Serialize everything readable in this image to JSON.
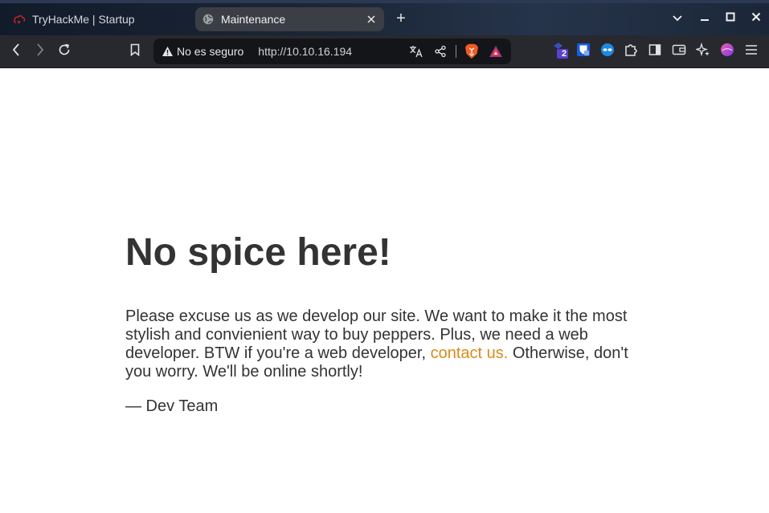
{
  "browser": {
    "tabs": [
      {
        "title": "TryHackMe | Startup",
        "favicon": "tryhackme-cloud-icon",
        "active": false
      },
      {
        "title": "Maintenance",
        "favicon": "globe-icon",
        "active": true
      }
    ],
    "new_tab": "+",
    "window_controls": [
      "chevron-down-icon",
      "minimize-icon",
      "maximize-icon",
      "close-icon"
    ],
    "address_bar": {
      "security_label": "No es seguro",
      "url": "http://10.10.16.194"
    },
    "extensions": {
      "badge_count": "2"
    },
    "colors": {
      "tabstrip": "#1b2638",
      "toolbar": "#27292e",
      "urlbar": "#141518",
      "active_tab": "#3b3e45"
    }
  },
  "page": {
    "heading": "No spice here!",
    "paragraph_before_link": "Please excuse us as we develop our site. We want to make it the most stylish and convienient way to buy peppers. Plus, we need a web developer. BTW if you're a web developer, ",
    "link_text": "contact us.",
    "paragraph_after_link": " Otherwise, don't you worry. We'll be online shortly!",
    "signature": "— Dev Team",
    "colors": {
      "text": "#333333",
      "link": "#d98a1a",
      "background": "#ffffff"
    }
  }
}
